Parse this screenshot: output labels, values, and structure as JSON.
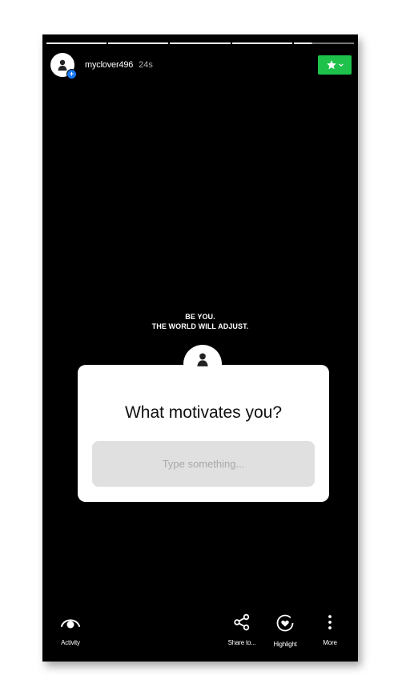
{
  "story": {
    "progress_segments": 5,
    "username": "myclover496",
    "timestamp": "24s",
    "close_friends_icon": "star-icon",
    "quote_lines": [
      "BE YOU.",
      "THE WORLD WILL ADJUST."
    ]
  },
  "question_sticker": {
    "question": "What motivates you?",
    "placeholder": "Type something..."
  },
  "bottom_bar": {
    "activity": "Activity",
    "share": "Share to...",
    "highlight": "Highlight",
    "more": "More"
  },
  "colors": {
    "background": "#000000",
    "close_friends_green": "#1ec14a",
    "avatar_badge_blue": "#1877f2"
  }
}
